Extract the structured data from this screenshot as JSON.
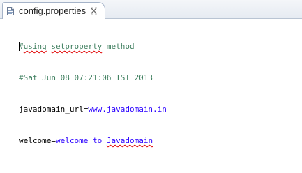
{
  "tab": {
    "icon": "properties-file-icon",
    "title": "config.properties",
    "close_icon": "close-icon"
  },
  "editor": {
    "lines": [
      {
        "comment_hash": "#",
        "comment_word1": "using",
        "comment_space": " ",
        "comment_word2": "setproperty",
        "comment_rest": " method"
      },
      {
        "comment": "#Sat Jun 08 07:21:06 IST 2013"
      },
      {
        "key": "javadomain_url",
        "eq": "=",
        "value": "www.javadomain.in"
      },
      {
        "key": "welcome",
        "eq": "=",
        "value_plain": "welcome to ",
        "value_squiggle": "Javadomain"
      }
    ]
  },
  "colors": {
    "comment": "#3f7f5f",
    "value": "#2a00ff",
    "key": "#000000"
  }
}
